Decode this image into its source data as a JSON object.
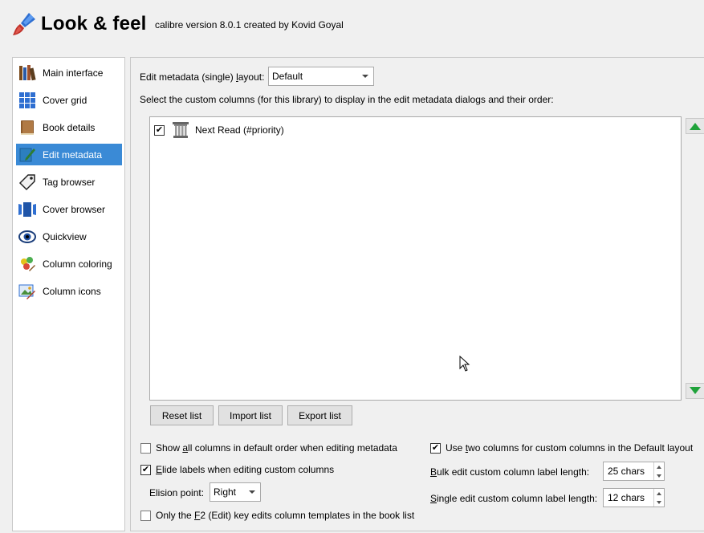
{
  "header": {
    "title": "Look & feel",
    "subtitle": "calibre version 8.0.1 created by Kovid Goyal",
    "icon": "paintbrush-icon"
  },
  "sidebar": {
    "items": [
      {
        "label": "Main interface",
        "icon": "books-icon"
      },
      {
        "label": "Cover grid",
        "icon": "grid-icon"
      },
      {
        "label": "Book details",
        "icon": "book-icon"
      },
      {
        "label": "Edit metadata",
        "icon": "edit-icon",
        "selected": true
      },
      {
        "label": "Tag browser",
        "icon": "tag-icon"
      },
      {
        "label": "Cover browser",
        "icon": "cover-flow-icon"
      },
      {
        "label": "Quickview",
        "icon": "eye-icon"
      },
      {
        "label": "Column coloring",
        "icon": "palette-icon"
      },
      {
        "label": "Column icons",
        "icon": "image-icon"
      }
    ]
  },
  "main": {
    "layout_label_pre": "Edit metadata (single) ",
    "layout_label_ul": "l",
    "layout_label_post": "ayout:",
    "layout_value": "Default",
    "columns_instruction": "Select the custom columns (for this library) to display in the edit metadata dialogs and their order:",
    "columns_list": [
      {
        "label": "Next Read (#priority)",
        "checked": true,
        "icon": "column-icon"
      }
    ],
    "buttons": {
      "reset": "Reset list",
      "import": "Import list",
      "export": "Export list"
    },
    "options": {
      "show_all_pre": "Show ",
      "show_all_ul": "a",
      "show_all_post": "ll columns in default order when editing metadata",
      "show_all_checked": false,
      "elide_ul": "E",
      "elide_post": "lide labels when editing custom columns",
      "elide_checked": true,
      "elision_label": "Elision point:",
      "elision_value": "Right",
      "f2_pre": "Only the ",
      "f2_ul": "F",
      "f2_post": "2 (Edit) key edits column templates in the book list",
      "f2_checked": false,
      "two_cols_pre": "Use ",
      "two_cols_ul": "t",
      "two_cols_post": "wo columns for custom columns in the Default layout",
      "two_cols_checked": true,
      "bulk_ul": "B",
      "bulk_post": "ulk edit custom column label length:",
      "bulk_value": "25 chars",
      "single_ul": "S",
      "single_post": "ingle edit custom column label length:",
      "single_value": "12 chars"
    }
  },
  "colors": {
    "selection": "#3a8ad6",
    "arrow_green": "#1fa23a"
  }
}
